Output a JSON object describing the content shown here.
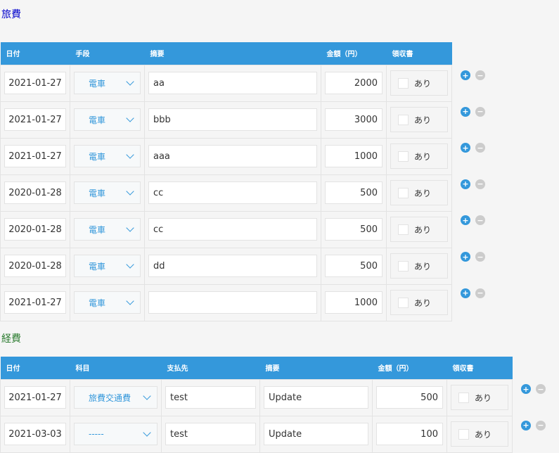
{
  "travel": {
    "title": "旅費",
    "title_color": "#0000cc",
    "headers": [
      "日付",
      "手段",
      "摘要",
      "金額（円）",
      "領収書"
    ],
    "rows": [
      {
        "date": "2021-01-27",
        "method": "電車",
        "summary": "aa",
        "amount": "2000",
        "receipt": "あり"
      },
      {
        "date": "2021-01-27",
        "method": "電車",
        "summary": "bbb",
        "amount": "3000",
        "receipt": "あり"
      },
      {
        "date": "2021-01-27",
        "method": "電車",
        "summary": "aaa",
        "amount": "1000",
        "receipt": "あり"
      },
      {
        "date": "2020-01-28",
        "method": "電車",
        "summary": "cc",
        "amount": "500",
        "receipt": "あり"
      },
      {
        "date": "2020-01-28",
        "method": "電車",
        "summary": "cc",
        "amount": "500",
        "receipt": "あり"
      },
      {
        "date": "2020-01-28",
        "method": "電車",
        "summary": "dd",
        "amount": "500",
        "receipt": "あり"
      },
      {
        "date": "2021-01-27",
        "method": "電車",
        "summary": "",
        "amount": "1000",
        "receipt": "あり"
      }
    ]
  },
  "expenses": {
    "title": "経費",
    "title_color": "#2e7d32",
    "headers": [
      "日付",
      "科目",
      "支払先",
      "摘要",
      "金額（円）",
      "領収書"
    ],
    "rows": [
      {
        "date": "2021-01-27",
        "account": "旅費交通費",
        "payee": "test",
        "summary": "Update",
        "amount": "500",
        "receipt": "あり"
      },
      {
        "date": "2021-03-03",
        "account": "-----",
        "payee": "test",
        "summary": "Update",
        "amount": "100",
        "receipt": "あり"
      }
    ]
  },
  "icons": {
    "add": "plus-circle-icon",
    "remove": "minus-circle-icon",
    "dropdown": "chevron-down-icon"
  },
  "colors": {
    "header": "#3498db",
    "add_button": "#3498db",
    "remove_button": "#cccccc"
  }
}
